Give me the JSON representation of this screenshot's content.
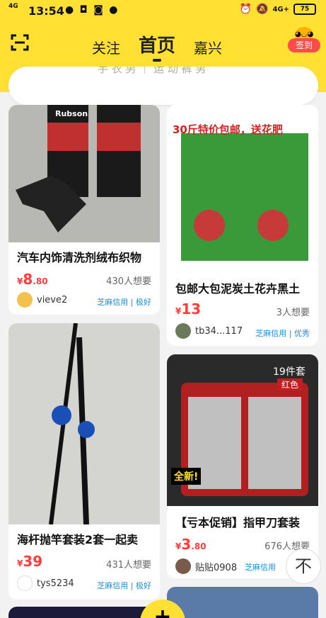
{
  "status_bar": {
    "time": "13:54",
    "signal": "4G",
    "network_right": "4G+",
    "battery": "75"
  },
  "header": {
    "tabs": [
      {
        "label": "关注"
      },
      {
        "label": "首页"
      },
      {
        "label": "嘉兴"
      }
    ],
    "checkin_label": "签到",
    "search_placeholder": "手 衣 男 ｜ 运 动 裤 男"
  },
  "cards": [
    {
      "title": "汽车内饰清洗剂绒布织物",
      "price_int": "8",
      "price_dec": ".80",
      "want": "430人想要",
      "seller": "vieve2",
      "credit": "芝麻信用 | 极好",
      "image_text": "Rubson"
    },
    {
      "title": "包邮大包泥炭土花卉黑土",
      "price_int": "13",
      "price_dec": "",
      "want": "3人想要",
      "seller": "tb34...117",
      "credit": "芝麻信用 | 优秀",
      "image_text": "30斤特价包邮，送花肥"
    },
    {
      "title": "海杆抛竿套装2套一起卖",
      "price_int": "39",
      "price_dec": "",
      "want": "431人想要",
      "seller": "tys5234",
      "credit": "芝麻信用 | 极好",
      "image_text": ""
    },
    {
      "title": "【亏本促销】指甲刀套装",
      "price_int": "3",
      "price_dec": ".80",
      "want": "676人想要",
      "seller": "贴贴0908",
      "credit": "芝麻信用",
      "image_text": "19件套",
      "image_badge": "红色",
      "image_sticker": "全新!"
    }
  ],
  "currency": "¥",
  "back_to_top": "不"
}
